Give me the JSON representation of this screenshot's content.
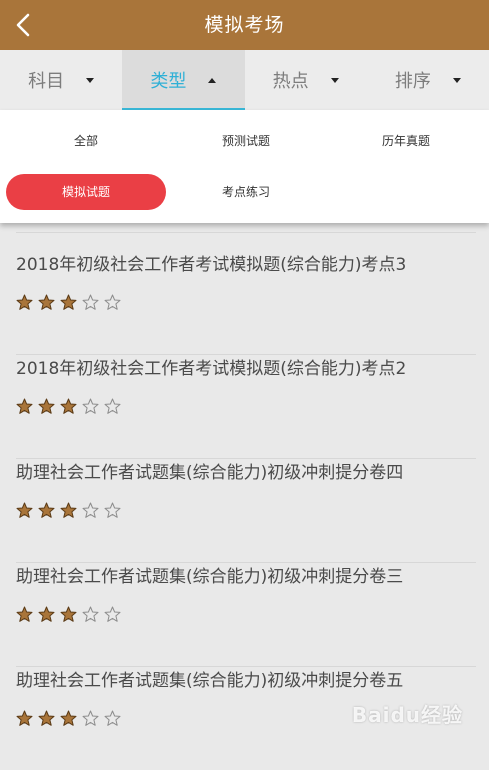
{
  "header": {
    "title": "模拟考场",
    "back_icon": "chevron-left-icon"
  },
  "filters": [
    {
      "label": "科目",
      "active": false,
      "arrow": "down"
    },
    {
      "label": "类型",
      "active": true,
      "arrow": "up"
    },
    {
      "label": "热点",
      "active": false,
      "arrow": "down"
    },
    {
      "label": "排序",
      "active": false,
      "arrow": "down"
    }
  ],
  "type_options": [
    {
      "label": "全部",
      "selected": false
    },
    {
      "label": "预测试题",
      "selected": false
    },
    {
      "label": "历年真题",
      "selected": false
    },
    {
      "label": "模拟试题",
      "selected": true
    },
    {
      "label": "考点练习",
      "selected": false
    }
  ],
  "exams": [
    {
      "title": "2018年初级社会工作者考试模拟题(综合能力)考点3",
      "rating": 3,
      "max_rating": 5
    },
    {
      "title": "2018年初级社会工作者考试模拟题(综合能力)考点2",
      "rating": 3,
      "max_rating": 5
    },
    {
      "title": "助理社会工作者试题集(综合能力)初级冲刺提分卷四",
      "rating": 3,
      "max_rating": 5
    },
    {
      "title": "助理社会工作者试题集(综合能力)初级冲刺提分卷三",
      "rating": 3,
      "max_rating": 5
    },
    {
      "title": "助理社会工作者试题集(综合能力)初级冲刺提分卷五",
      "rating": 3,
      "max_rating": 5
    }
  ],
  "watermark": "Baidu经验",
  "colors": {
    "header": "#a9753a",
    "accent": "#2fb0d6",
    "selected_pill": "#ea3f45",
    "star": "#a9753a"
  }
}
